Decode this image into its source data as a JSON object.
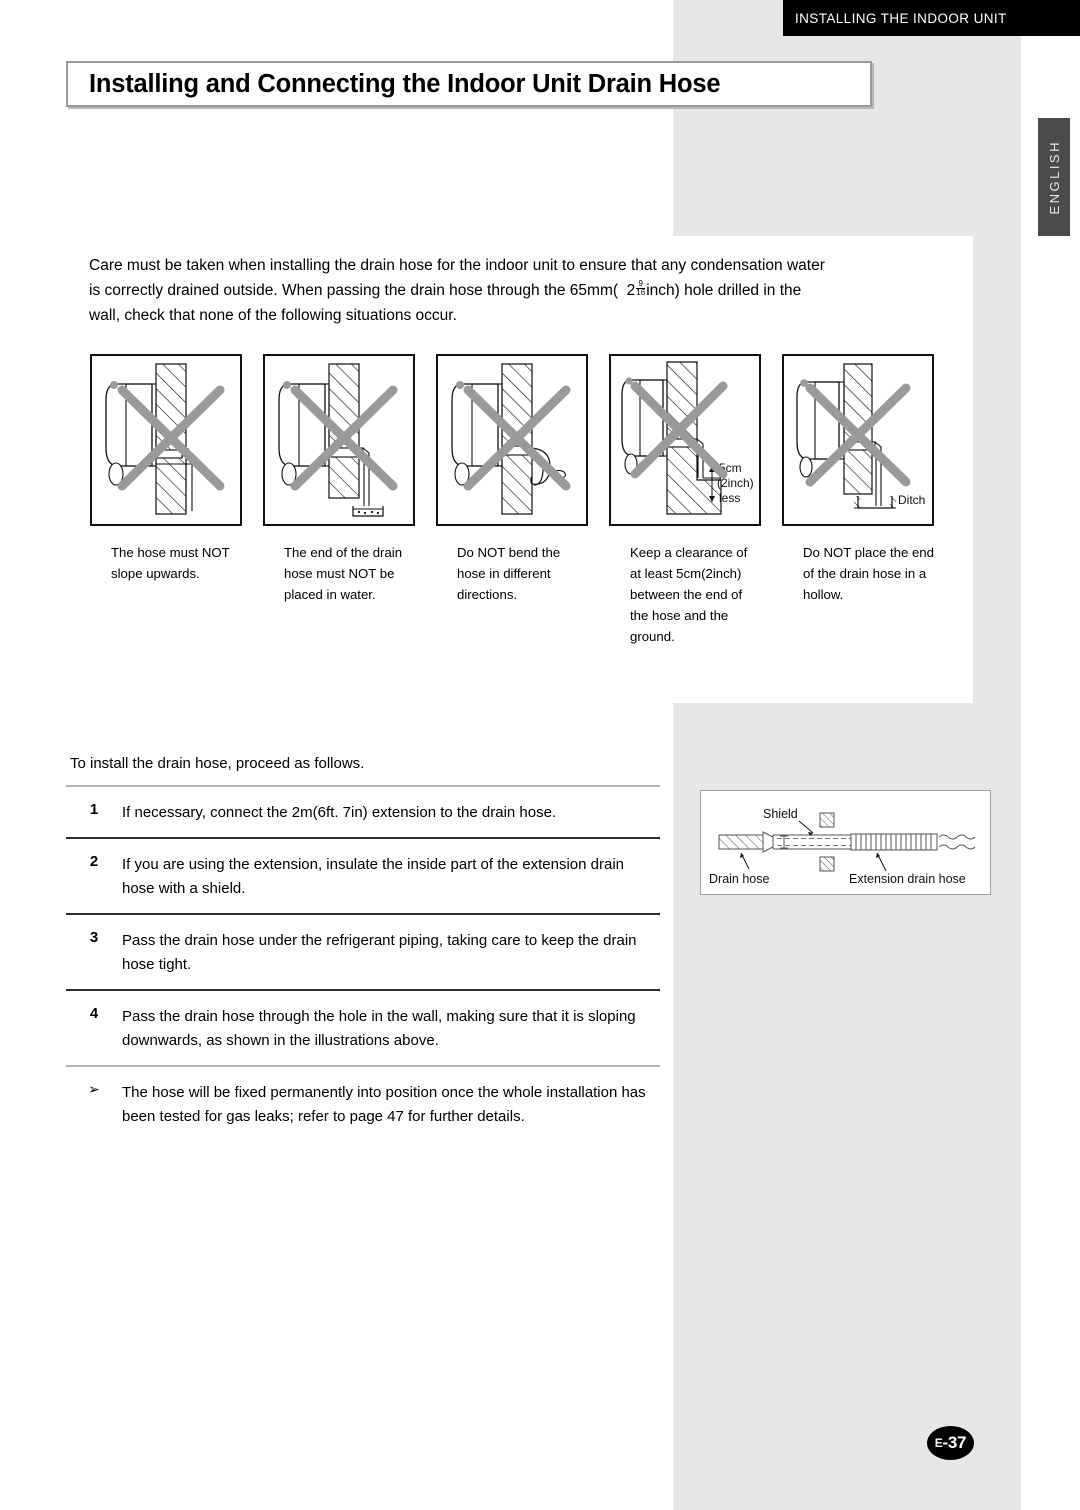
{
  "header": {
    "running_title": "INSTALLING THE INDOOR UNIT",
    "language_tab": "ENGLISH"
  },
  "title": {
    "text": "Installing and Connecting the Indoor Unit Drain Hose"
  },
  "intro": {
    "line1": "Care must be taken when installing the drain hose for the indoor unit to ensure that any",
    "line2": "condensation water is correctly drained outside. When passing the drain hose through",
    "line3_before": "the 65mm(",
    "line3_whole": "2",
    "line3_numerator": "9",
    "line3_denominator": "16",
    "line3_after": "inch) hole drilled in the wall, check that none of the following situations occur."
  },
  "illustrations": [
    {
      "id": "no-upward-slope",
      "caption": "The hose must NOT slope upwards.",
      "labels": []
    },
    {
      "id": "no-hose-in-water",
      "caption": "The end of the drain hose must NOT be placed in water.",
      "labels": []
    },
    {
      "id": "no-bending",
      "caption": "Do NOT bend the hose in different directions.",
      "labels": []
    },
    {
      "id": "ground-clearance",
      "caption": "Keep a clearance of at least 5cm(2inch) between the end of the hose and the ground.",
      "labels": [
        "5cm",
        "(2inch)",
        "less"
      ]
    },
    {
      "id": "no-hollow",
      "caption": "Do NOT place the end of the drain hose in a hollow.",
      "labels": [
        "Ditch"
      ]
    }
  ],
  "procedure": {
    "lead_in": "To install the drain hose, proceed as follows.",
    "steps": [
      {
        "number": "1",
        "text": "If necessary, connect the 2m(6ft. 7in) extension to the drain hose."
      },
      {
        "number": "2",
        "text": "If you are using the extension, insulate the inside part of the extension drain hose with a shield."
      },
      {
        "number": "3",
        "text": "Pass the drain hose under the refrigerant piping, taking care to keep the drain hose tight."
      },
      {
        "number": "4",
        "text": "Pass the drain hose through the hole in the wall, making sure that it is sloping downwards, as shown in the illustrations above."
      }
    ],
    "note": {
      "marker": "➢",
      "text": "The hose will be fixed permanently into position once the whole installation has been tested for gas leaks; refer to page 47 for further details."
    }
  },
  "extension_diagram": {
    "label_shield": "Shield",
    "label_drain_hose": "Drain hose",
    "label_extension_drain_hose": "Extension drain hose"
  },
  "footer": {
    "page_prefix": "E",
    "page_number": "-37"
  },
  "colors": {
    "panel_gray": "#e7e7e7",
    "header_black": "#000000",
    "tab_gray": "#4b4b4b",
    "cross_gray": "#9a9a9a",
    "rule_light": "#b3b3b3",
    "rule_dark": "#2e2e2e"
  }
}
